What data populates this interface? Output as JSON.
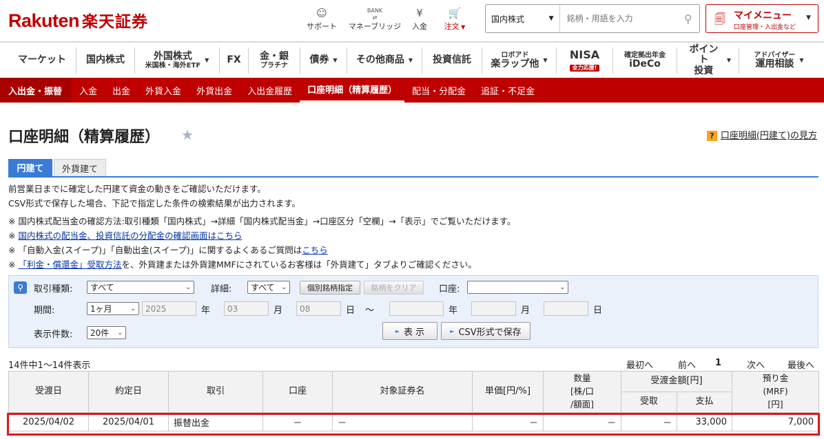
{
  "header": {
    "logo_en": "Rakuten",
    "logo_jp": "楽天証券",
    "icons": [
      {
        "label": "サポート",
        "icon": "support-icon"
      },
      {
        "label": "マネーブリッジ",
        "icon": "bank-icon"
      },
      {
        "label": "入金",
        "icon": "yen-deposit-icon"
      },
      {
        "label": "注文",
        "icon": "cart-icon"
      }
    ],
    "bank_text": "BANK",
    "search": {
      "category": "国内株式",
      "placeholder": "銘柄・用語を入力"
    },
    "my_menu": {
      "title": "マイメニュー",
      "sub": "口座管理・入出金など"
    }
  },
  "gnav": [
    {
      "label": "マーケット"
    },
    {
      "label": "国内株式"
    },
    {
      "label": "外国株式",
      "sub": "米国株・海外ETF"
    },
    {
      "label": "FX"
    },
    {
      "label": "金・銀",
      "sub": "プラチナ"
    },
    {
      "label": "債券"
    },
    {
      "label": "その他商品"
    },
    {
      "label": "投資信託"
    },
    {
      "label": "楽ラップ他",
      "sup": "ロボアド"
    },
    {
      "label": "NISA",
      "badge": "全力応援!"
    },
    {
      "label": "iDeCo",
      "sup": "確定拠出年金"
    },
    {
      "label": "ポイント",
      "sub": "投資"
    },
    {
      "label": "運用相談",
      "sup": "アドバイザー"
    }
  ],
  "rnav": {
    "lead": "入出金・振替",
    "items": [
      "入金",
      "出金",
      "外貨入金",
      "外貨出金",
      "入出金履歴",
      "口座明細（精算履歴）",
      "配当・分配金",
      "追証・不足金"
    ]
  },
  "page": {
    "title": "口座明細（精算履歴）",
    "howto": "口座明細(円建て)の見方",
    "tabs": [
      "円建て",
      "外貨建て"
    ]
  },
  "desc": {
    "line1": "前営業日までに確定した円建て資金の動きをご確認いただけます。",
    "line2": "CSV形式で保存した場合、下記で指定した条件の検索結果が出力されます。",
    "note1": "※  国内株式配当金の確認方法:取引種類「国内株式」→詳細「国内株式配当金」→口座区分「空欄」→「表示」でご覧いただけます。",
    "note2_prefix": "※  ",
    "note2_link": "国内株式の配当金、投資信託の分配金の確認画面はこちら",
    "note3_text": "※  「自動入金(スイープ)」「自動出金(スイープ)」に関するよくあるご質問は",
    "note3_link": "こちら",
    "note4_prefix": "※  ",
    "note4_link": "「利金・償還金」受取方法",
    "note4_text": "を、外貨建または外貨建MMFにされているお客様は「外貨建て」タブよりご確認ください。"
  },
  "search": {
    "type_label": "取引種類:",
    "type_value": "すべて",
    "detail_label": "詳細:",
    "detail_value": "すべて",
    "btn_specify": "個別銘柄指定",
    "btn_clear": "銘柄をクリア",
    "account_label": "口座:",
    "account_value": "",
    "period_label": "期間:",
    "period_value": "1ヶ月",
    "from_year": "2025",
    "from_month": "03",
    "from_day": "08",
    "to_year": "",
    "to_month": "",
    "to_day": "",
    "year_unit": "年",
    "month_unit": "月",
    "day_unit": "日",
    "tilde": "～",
    "count_label": "表示件数:",
    "count_value": "20件",
    "btn_show": "表 示",
    "btn_csv": "CSV形式で保存"
  },
  "results": {
    "summary": "14件中1～14件表示",
    "pager": {
      "first": "最初へ",
      "prev": "前へ",
      "page": "1",
      "next": "次へ",
      "last": "最後へ"
    }
  },
  "table": {
    "headers": {
      "settle_date": "受渡日",
      "trade_date": "約定日",
      "type": "取引",
      "account": "口座",
      "security": "対象証券名",
      "unit_price": "単価[円/%]",
      "quantity": "数量\n[株/口\n/額面]",
      "amount": "受渡金額[円]",
      "receive": "受取",
      "pay": "支払",
      "deposit": "預り金\n(MRF)\n[円]"
    },
    "rows": [
      {
        "settle_date": "2025/04/02",
        "trade_date": "2025/04/01",
        "type": "振替出金",
        "account": "－",
        "security": "－",
        "unit_price": "－",
        "quantity": "－",
        "receive": "－",
        "pay": "33,000",
        "deposit": "7,000"
      }
    ]
  }
}
